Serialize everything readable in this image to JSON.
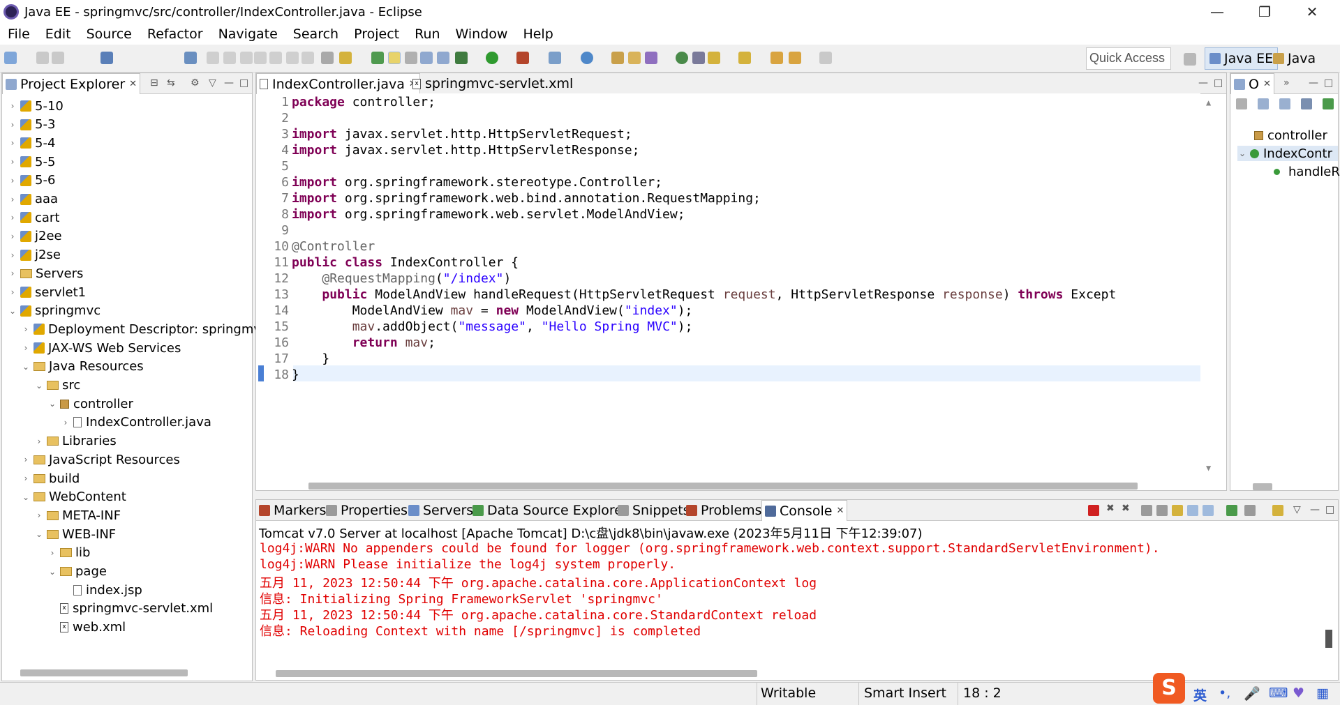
{
  "window": {
    "title": "Java EE - springmvc/src/controller/IndexController.java - Eclipse",
    "minimize": "—",
    "restore": "❐",
    "close": "✕"
  },
  "menu": [
    "File",
    "Edit",
    "Source",
    "Refactor",
    "Navigate",
    "Search",
    "Project",
    "Run",
    "Window",
    "Help"
  ],
  "toolbar": {
    "quick_access": "Quick Access",
    "perspectives": [
      "Java EE",
      "Java"
    ]
  },
  "project_explorer": {
    "title": "Project Explorer",
    "items": [
      {
        "label": "5-10",
        "depth": 0,
        "icon": "project-icon",
        "twisty": "›"
      },
      {
        "label": "5-3",
        "depth": 0,
        "icon": "project-icon",
        "twisty": "›"
      },
      {
        "label": "5-4",
        "depth": 0,
        "icon": "project-icon",
        "twisty": "›"
      },
      {
        "label": "5-5",
        "depth": 0,
        "icon": "project-icon",
        "twisty": "›"
      },
      {
        "label": "5-6",
        "depth": 0,
        "icon": "project-icon",
        "twisty": "›"
      },
      {
        "label": "aaa",
        "depth": 0,
        "icon": "project-icon",
        "twisty": "›"
      },
      {
        "label": "cart",
        "depth": 0,
        "icon": "project-icon",
        "twisty": "›"
      },
      {
        "label": "j2ee",
        "depth": 0,
        "icon": "project-icon",
        "twisty": "›"
      },
      {
        "label": "j2se",
        "depth": 0,
        "icon": "project-icon",
        "twisty": "›"
      },
      {
        "label": "Servers",
        "depth": 0,
        "icon": "folder-icon",
        "twisty": "›"
      },
      {
        "label": "servlet1",
        "depth": 0,
        "icon": "project-icon",
        "twisty": "›"
      },
      {
        "label": "springmvc",
        "depth": 0,
        "icon": "project-icon",
        "twisty": "⌄"
      },
      {
        "label": "Deployment Descriptor: springmvc",
        "depth": 1,
        "icon": "descriptor-icon",
        "twisty": "›"
      },
      {
        "label": "JAX-WS Web Services",
        "depth": 1,
        "icon": "webservice-icon",
        "twisty": "›"
      },
      {
        "label": "Java Resources",
        "depth": 1,
        "icon": "folder-icon",
        "twisty": "⌄"
      },
      {
        "label": "src",
        "depth": 2,
        "icon": "folder-icon",
        "twisty": "⌄"
      },
      {
        "label": "controller",
        "depth": 3,
        "icon": "package-icon",
        "twisty": "⌄"
      },
      {
        "label": "IndexController.java",
        "depth": 4,
        "icon": "java-file-icon",
        "twisty": "›"
      },
      {
        "label": "Libraries",
        "depth": 2,
        "icon": "library-icon",
        "twisty": "›"
      },
      {
        "label": "JavaScript Resources",
        "depth": 1,
        "icon": "js-resources-icon",
        "twisty": "›"
      },
      {
        "label": "build",
        "depth": 1,
        "icon": "folder-icon",
        "twisty": "›"
      },
      {
        "label": "WebContent",
        "depth": 1,
        "icon": "folder-icon",
        "twisty": "⌄"
      },
      {
        "label": "META-INF",
        "depth": 2,
        "icon": "folder-icon",
        "twisty": "›"
      },
      {
        "label": "WEB-INF",
        "depth": 2,
        "icon": "folder-icon",
        "twisty": "⌄"
      },
      {
        "label": "lib",
        "depth": 3,
        "icon": "folder-icon",
        "twisty": "›"
      },
      {
        "label": "page",
        "depth": 3,
        "icon": "folder-icon",
        "twisty": "⌄"
      },
      {
        "label": "index.jsp",
        "depth": 4,
        "icon": "jsp-file-icon",
        "twisty": ""
      },
      {
        "label": "springmvc-servlet.xml",
        "depth": 3,
        "icon": "xml-file-icon",
        "twisty": ""
      },
      {
        "label": "web.xml",
        "depth": 3,
        "icon": "xml-file-icon",
        "twisty": ""
      }
    ]
  },
  "editor": {
    "tabs": [
      "IndexController.java",
      "springmvc-servlet.xml"
    ],
    "line_numbers": [
      "1",
      "2",
      "3",
      "4",
      "5",
      "6",
      "7",
      "8",
      "9",
      "10",
      "11",
      "12",
      "13",
      "14",
      "15",
      "16",
      "17",
      "18"
    ],
    "lines": [
      [
        {
          "t": "package",
          "c": "kw"
        },
        {
          "t": " controller;",
          "c": ""
        }
      ],
      [],
      [
        {
          "t": "import",
          "c": "kw"
        },
        {
          "t": " javax.servlet.http.HttpServletRequest;",
          "c": ""
        }
      ],
      [
        {
          "t": "import",
          "c": "kw"
        },
        {
          "t": " javax.servlet.http.HttpServletResponse;",
          "c": ""
        }
      ],
      [],
      [
        {
          "t": "import",
          "c": "kw"
        },
        {
          "t": " org.springframework.stereotype.Controller;",
          "c": ""
        }
      ],
      [
        {
          "t": "import",
          "c": "kw"
        },
        {
          "t": " org.springframework.web.bind.annotation.RequestMapping;",
          "c": ""
        }
      ],
      [
        {
          "t": "import",
          "c": "kw"
        },
        {
          "t": " org.springframework.web.servlet.ModelAndView;",
          "c": ""
        }
      ],
      [],
      [
        {
          "t": "@Controller",
          "c": "ann"
        }
      ],
      [
        {
          "t": "public",
          "c": "kw"
        },
        {
          "t": " ",
          "c": ""
        },
        {
          "t": "class",
          "c": "kw"
        },
        {
          "t": " IndexController {",
          "c": ""
        }
      ],
      [
        {
          "t": "    ",
          "c": ""
        },
        {
          "t": "@RequestMapping",
          "c": "ann"
        },
        {
          "t": "(",
          "c": ""
        },
        {
          "t": "\"/index\"",
          "c": "str"
        },
        {
          "t": ")",
          "c": ""
        }
      ],
      [
        {
          "t": "    ",
          "c": ""
        },
        {
          "t": "public",
          "c": "kw"
        },
        {
          "t": " ModelAndView handleRequest(HttpServletRequest ",
          "c": ""
        },
        {
          "t": "request",
          "c": "par"
        },
        {
          "t": ", HttpServletResponse ",
          "c": ""
        },
        {
          "t": "response",
          "c": "par"
        },
        {
          "t": ") ",
          "c": ""
        },
        {
          "t": "throws",
          "c": "kw"
        },
        {
          "t": " Except",
          "c": ""
        }
      ],
      [
        {
          "t": "        ModelAndView ",
          "c": ""
        },
        {
          "t": "mav",
          "c": "par"
        },
        {
          "t": " = ",
          "c": ""
        },
        {
          "t": "new",
          "c": "kw"
        },
        {
          "t": " ModelAndView(",
          "c": ""
        },
        {
          "t": "\"index\"",
          "c": "str"
        },
        {
          "t": ");",
          "c": ""
        }
      ],
      [
        {
          "t": "        ",
          "c": ""
        },
        {
          "t": "mav",
          "c": "par"
        },
        {
          "t": ".addObject(",
          "c": ""
        },
        {
          "t": "\"message\"",
          "c": "str"
        },
        {
          "t": ", ",
          "c": ""
        },
        {
          "t": "\"Hello Spring MVC\"",
          "c": "str"
        },
        {
          "t": ");",
          "c": ""
        }
      ],
      [
        {
          "t": "        ",
          "c": ""
        },
        {
          "t": "return",
          "c": "kw"
        },
        {
          "t": " ",
          "c": ""
        },
        {
          "t": "mav",
          "c": "par"
        },
        {
          "t": ";",
          "c": ""
        }
      ],
      [
        {
          "t": "    }",
          "c": ""
        }
      ],
      [
        {
          "t": "}",
          "c": ""
        }
      ]
    ]
  },
  "outline": {
    "tab": "O",
    "items": [
      "controller",
      "IndexContr",
      "handleR"
    ]
  },
  "bottom_tabs": [
    "Markers",
    "Properties",
    "Servers",
    "Data Source Explorer",
    "Snippets",
    "Problems",
    "Console"
  ],
  "console": {
    "header": "Tomcat v7.0 Server at localhost [Apache Tomcat] D:\\c盘\\jdk8\\bin\\javaw.exe (2023年5月11日 下午12:39:07)",
    "lines": [
      "log4j:WARN No appenders could be found for logger (org.springframework.web.context.support.StandardServletEnvironment).",
      "log4j:WARN Please initialize the log4j system properly.",
      "五月 11, 2023 12:50:44 下午 org.apache.catalina.core.ApplicationContext log",
      "信息: Initializing Spring FrameworkServlet 'springmvc'",
      "五月 11, 2023 12:50:44 下午 org.apache.catalina.core.StandardContext reload",
      "信息: Reloading Context with name [/springmvc] is completed"
    ]
  },
  "status": {
    "writable": "Writable",
    "insert_mode": "Smart Insert",
    "position": "18 : 2",
    "ime_label": "英"
  },
  "colors": {
    "keyword": "#7f0055",
    "string": "#2a00ff",
    "annotation": "#646464",
    "console_error": "#e00000",
    "current_line": "#e8f2fe"
  }
}
